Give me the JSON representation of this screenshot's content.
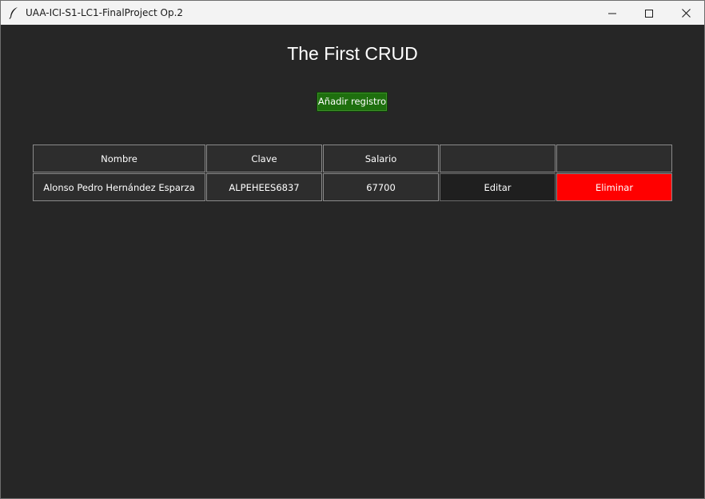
{
  "window": {
    "title": "UAA-ICI-S1-LC1-FinalProject Op.2",
    "icon": "feather-icon",
    "controls": {
      "minimize_icon": "minimize-icon",
      "maximize_icon": "maximize-icon",
      "close_icon": "close-icon"
    }
  },
  "main": {
    "title": "The First CRUD",
    "add_button_label": "Añadir registro"
  },
  "table": {
    "headers": [
      "Nombre",
      "Clave",
      "Salario",
      "",
      ""
    ],
    "rows": [
      {
        "nombre": "Alonso Pedro Hernández Esparza",
        "clave": "ALPEHEES6837",
        "salario": "67700",
        "edit_label": "Editar",
        "delete_label": "Eliminar"
      }
    ]
  },
  "colors": {
    "background": "#262626",
    "titlebar": "#f3f3f3",
    "add_button": "#1e6f0e",
    "delete_button": "#ff0000",
    "edit_button": "#1f1f1f",
    "text": "#ffffff"
  }
}
